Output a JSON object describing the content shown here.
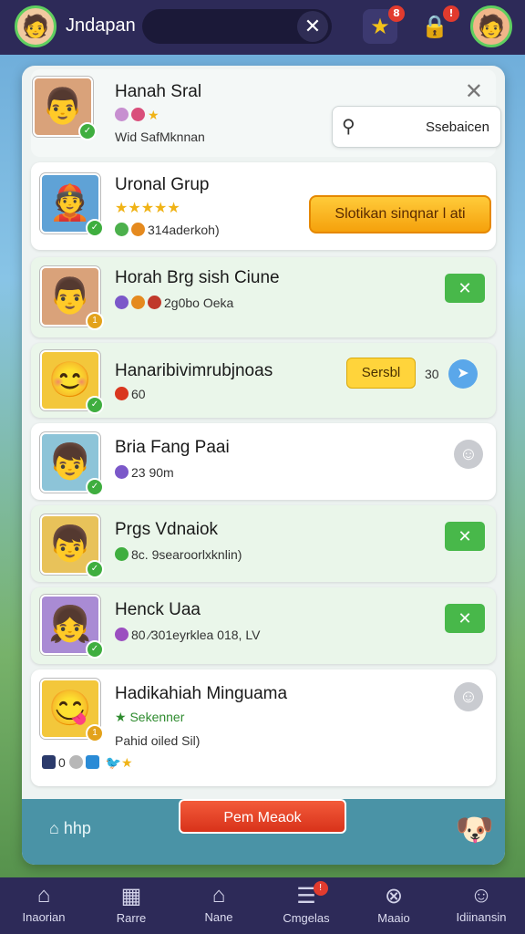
{
  "topbar": {
    "title": "Jndapan",
    "close_label": "✕",
    "notif_badge_1": "8",
    "notif_badge_2": "!"
  },
  "search": {
    "label": "Ssebaicen"
  },
  "rows": [
    {
      "name": "Hanah Sral",
      "meta": "Wid SafMknnan"
    },
    {
      "name": "Uronal Grup",
      "stars": "★★★★★",
      "meta": "314aderkoh)",
      "action": "Slotikan sinqnar l ati"
    },
    {
      "name": "Horah Brg sish Ciune",
      "meta": "2g0bo Oeka"
    },
    {
      "name": "Hanaribivimrubjnoas",
      "meta": "60",
      "action": "Sersbl",
      "count": "30"
    },
    {
      "name": "Bria Fang Paai",
      "meta": "2⁠3 90m"
    },
    {
      "name": "Prgs Vdnaiok",
      "meta": "8c. 9searoorlxknlin)"
    },
    {
      "name": "Henck Uaa",
      "meta": "80 ⁄301eyrklea 018, LV"
    },
    {
      "name": "Hadikahiah Minguama",
      "status": "Sekenner",
      "meta": "Pahid oiled Sil)",
      "footer_count": "0"
    }
  ],
  "footer": {
    "home_label": "hhp",
    "cta_label": "Pem Meaok"
  },
  "nav": [
    {
      "label": "Inaorian",
      "icon": "home-icon"
    },
    {
      "label": "Rarre",
      "icon": "calendar-icon"
    },
    {
      "label": "Nane",
      "icon": "house-icon"
    },
    {
      "label": "Cmgelas",
      "icon": "list-icon",
      "badge": "!"
    },
    {
      "label": "Maaio",
      "icon": "globe-icon"
    },
    {
      "label": "Idiinansin",
      "icon": "profile-icon"
    }
  ],
  "colors": {
    "topbar": "#2d2a58",
    "accent_green": "#48b84a",
    "accent_orange": "#f5a10c",
    "cta_red": "#d8321a"
  }
}
